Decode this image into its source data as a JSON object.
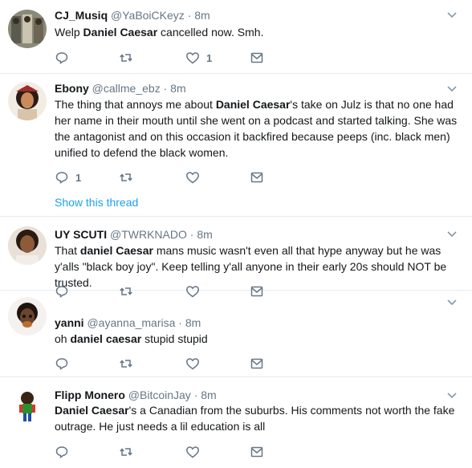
{
  "colors": {
    "text": "#14171a",
    "secondary": "#657786",
    "link": "#1da1f2",
    "divider": "#e6ecf0"
  },
  "icons": [
    "reply-icon",
    "retweet-icon",
    "like-icon",
    "message-icon",
    "caret-down-icon"
  ],
  "tweets": [
    {
      "fullname": "CJ_Musiq",
      "handle": "@YaBoiCKeyz",
      "dot": "·",
      "time": "8m",
      "text": {
        "bold1": "Daniel Caesar",
        "pre": "Welp ",
        "post": " cancelled now. Smh."
      },
      "reply_count": "",
      "like_count": "1"
    },
    {
      "fullname": "Ebony",
      "handle": "@callme_ebz",
      "dot": "·",
      "time": "8m",
      "text": {
        "pre": "The thing that annoys me about ",
        "bold1": "Daniel Caesar",
        "post": "'s take on Julz is that no one had her name in their mouth until she went on a podcast and started talking. She was the antagonist and on this occasion it backfired because peeps  (inc. black men) unified to defend the black women."
      },
      "reply_count": "1",
      "like_count": "",
      "show_thread": "Show this thread"
    },
    {
      "fullname": "UY SCUTI",
      "handle": "@TWRKNADO",
      "dot": "·",
      "time": "8m",
      "text": {
        "pre": "That ",
        "bold1": "daniel Caesar",
        "post": " mans music wasn't even all that hype anyway but he was y'alls \"black boy joy\". Keep telling y'all anyone in their early 20s should NOT be trusted."
      },
      "reply_count": "",
      "like_count": ""
    },
    {
      "fullname": "yanni",
      "handle": "@ayanna_marisa",
      "dot": "·",
      "time": "8m",
      "text": {
        "pre": "oh ",
        "bold1": "daniel caesar",
        "post": " stupid stupid"
      },
      "reply_count": "",
      "like_count": ""
    },
    {
      "fullname": "Flipp Monero",
      "handle": "@BitcoinJay",
      "dot": "·",
      "time": "8m",
      "text": {
        "pre": "",
        "bold1": "Daniel Caesar",
        "post": "'s a Canadian from the suburbs. His comments not worth the fake outrage. He just needs a lil education is all"
      },
      "reply_count": "",
      "like_count": ""
    }
  ]
}
